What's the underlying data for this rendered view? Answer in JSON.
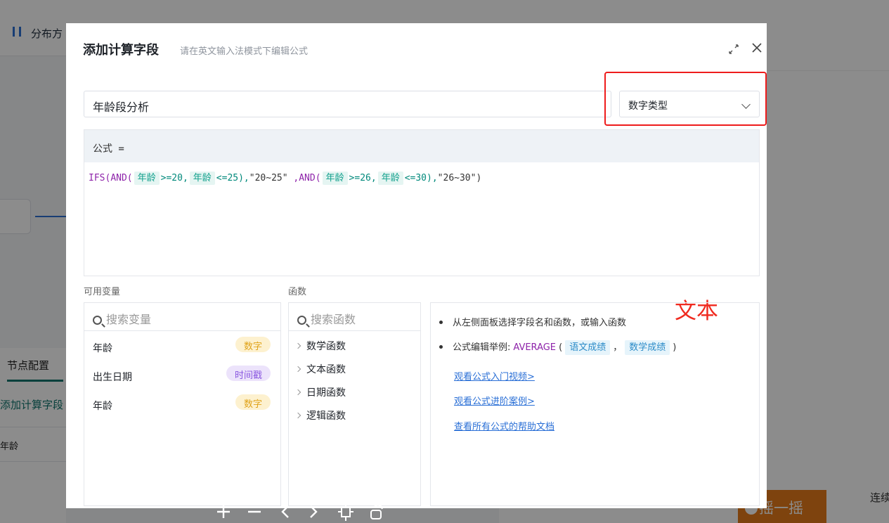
{
  "background": {
    "topbar_title": "分布方",
    "panel_tab": "节点配置",
    "panel_item": "添加计算字段",
    "panel_field": "年龄",
    "shake_button": "摇一摇",
    "continue_text": "连续"
  },
  "modal": {
    "title": "添加计算字段",
    "subtitle": "请在英文输入法模式下编辑公式",
    "field_name_value": "年龄段分析",
    "type_select_value": "数字类型",
    "formula_header": "公式 =",
    "annotation": "文本",
    "formula": {
      "fn_ifs": "IFS(",
      "fn_and": "AND(",
      "var_age": "年龄",
      "op_ge20": ">=20,",
      "op_le25": "<=25),",
      "str_1": "\"20~25\"",
      "sep_and": ",AND(",
      "op_ge26": ">=26,",
      "op_le30": "<=30),",
      "str_2": "\"26~30\")",
      "comma": ","
    },
    "vars_label": "可用变量",
    "funcs_label": "函数",
    "vars_search_placeholder": "搜索变量",
    "funcs_search_placeholder": "搜索函数",
    "variables": [
      {
        "name": "年龄",
        "type": "数字"
      },
      {
        "name": "出生日期",
        "type": "时间戳"
      },
      {
        "name": "年龄",
        "type": "数字"
      }
    ],
    "functions": [
      "数学函数",
      "文本函数",
      "日期函数",
      "逻辑函数"
    ],
    "help": {
      "tip1": "从左侧面板选择字段名和函数，或输入函数",
      "tip2_prefix": "公式编辑举例:",
      "tip2_fn": "AVERAGE",
      "tip2_open": "(",
      "tip2_var1": "语文成绩",
      "tip2_comma": "，",
      "tip2_var2": "数学成绩",
      "tip2_close": ")",
      "link1": "观看公式入门视频>",
      "link2": "观看公式进阶案例>",
      "link3": "查看所有公式的帮助文档"
    }
  },
  "colors": {
    "highlight_red": "#ee1c1c",
    "accent_teal": "#11a08c",
    "function_purple": "#8e24aa",
    "link_blue": "#2a6fd6"
  }
}
